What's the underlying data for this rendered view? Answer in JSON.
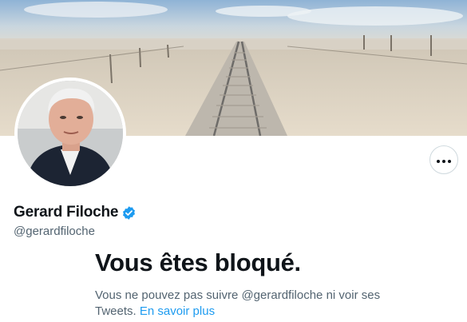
{
  "profile": {
    "display_name": "Gerard Filoche",
    "handle": "@gerardfiloche",
    "verified": true
  },
  "icons": {
    "verified": "verified-badge-icon",
    "more": "more-options-icon"
  },
  "blocked": {
    "title": "Vous êtes bloqué.",
    "message": "Vous ne pouvez pas suivre @gerardfiloche ni voir ses Tweets.",
    "learn_more": "En savoir plus"
  },
  "colors": {
    "accent": "#1d9bf0",
    "text_primary": "#0f1419",
    "text_secondary": "#536471",
    "border": "#cfd9de"
  }
}
